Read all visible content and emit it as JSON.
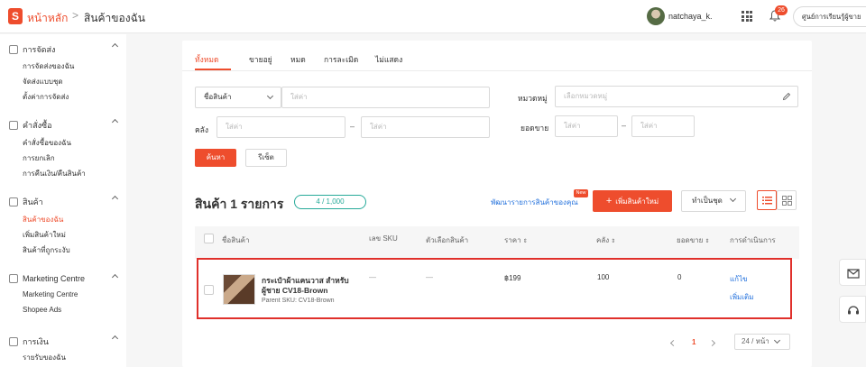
{
  "header": {
    "logo_letter": "S",
    "brand": "หน้าหลัก",
    "separator": ">",
    "breadcrumb": "สินค้าของฉัน",
    "username": "natchaya_k.",
    "notification_count": "26",
    "learn_button": "ศูนย์การเรียนรู้ผู้ขาย"
  },
  "sidebar": {
    "sections": [
      {
        "title": "การจัดส่ง",
        "items": [
          "การจัดส่งของฉัน",
          "จัดส่งแบบชุด",
          "ตั้งค่าการจัดส่ง"
        ]
      },
      {
        "title": "คำสั่งซื้อ",
        "items": [
          "คำสั่งซื้อของฉัน",
          "การยกเลิก",
          "การคืนเงิน/คืนสินค้า"
        ]
      },
      {
        "title": "สินค้า",
        "items": [
          "สินค้าของฉัน",
          "เพิ่มสินค้าใหม่",
          "สินค้าที่ถูกระงับ"
        ]
      },
      {
        "title": "Marketing Centre",
        "items": [
          "Marketing Centre",
          "Shopee Ads"
        ]
      },
      {
        "title": "การเงิน",
        "items": [
          "รายรับของฉัน"
        ]
      }
    ]
  },
  "tabs": [
    "ทั้งหมด",
    "ขายอยู่",
    "หมด",
    "การละเมิด",
    "ไม่แสดง"
  ],
  "filters": {
    "product_select": "ชื่อสินค้า",
    "product_placeholder": "ใส่ค่า",
    "category_label": "หมวดหมู่",
    "category_placeholder": "เลือกหมวดหมู่",
    "stock_label": "คลัง",
    "stock_min_placeholder": "ใส่ค่า",
    "stock_max_placeholder": "ใส่ค่า",
    "sales_label": "ยอดขาย",
    "sales_min_placeholder": "ใส่ค่า",
    "sales_max_placeholder": "ใส่ค่า",
    "range_dash": "–",
    "search_button": "ค้นหา",
    "reset_button": "รีเซ็ต"
  },
  "toolbar": {
    "count_title": "สินค้า 1 รายการ",
    "count_badge": "4 / 1,000",
    "optimize_link": "พัฒนารายการสินค้าของคุณ",
    "new_tag": "New",
    "add_button": "เพิ่มสินค้าใหม่",
    "bulk_button": "ทำเป็นชุด"
  },
  "table": {
    "columns": [
      "ชื่อสินค้า",
      "เลข SKU",
      "ตัวเลือกสินค้า",
      "ราคา",
      "คลัง",
      "ยอดขาย",
      "การดำเนินการ"
    ],
    "rows": [
      {
        "name": "กระเป๋าผ้าแคนวาส สำหรับผู้ชาย CV18-Brown",
        "parent_sku": "Parent SKU: CV18-Brown",
        "sku": "—",
        "variation": "—",
        "price": "฿199",
        "stock": "100",
        "sales": "0",
        "action_edit": "แก้ไข",
        "action_more": "เพิ่มเติม"
      }
    ]
  },
  "pagination": {
    "current_page": "1",
    "per_page": "24 / หน้า"
  },
  "colors": {
    "brand": "#ee4d2d",
    "link": "#2673dd",
    "badge": "#26aa99",
    "highlight": "#e0302b"
  }
}
